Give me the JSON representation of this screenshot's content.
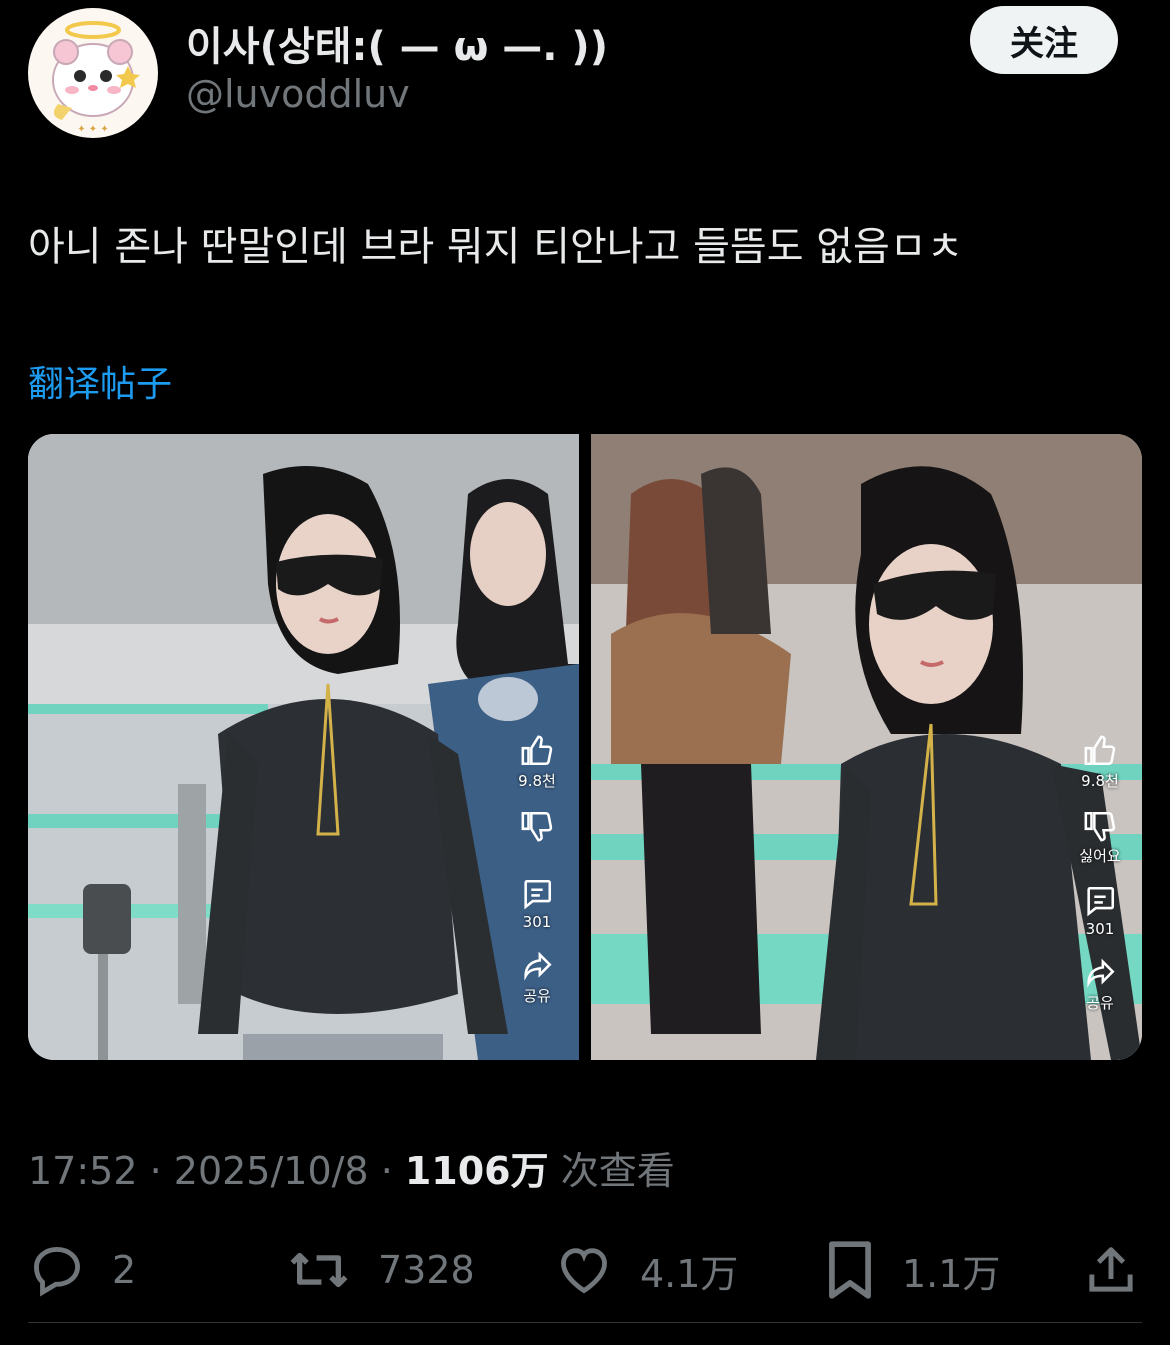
{
  "author": {
    "display_name": "이사(상태:( — ω —. ))",
    "handle": "@luvoddluv",
    "follow_label": "关注"
  },
  "post": {
    "text": "아니 존나 딴말인데 브라 뭐지 티안나고 들뜸도 없음ㅁㅊ",
    "translate_label": "翻译帖子"
  },
  "media": {
    "left_overlay": {
      "likes": "9.8천",
      "comments": "301",
      "share": "공유"
    },
    "right_overlay": {
      "likes": "9.8천",
      "dislike": "싫어요",
      "comments": "301",
      "share": "공유"
    }
  },
  "meta": {
    "time": "17:52",
    "separator": " · ",
    "date": "2025/10/8",
    "views": "1106万",
    "views_suffix": "次查看"
  },
  "actions": {
    "replies": "2",
    "reposts": "7328",
    "likes": "4.1万",
    "bookmarks": "1.1万"
  },
  "colors": {
    "background": "#000000",
    "text": "#e7e9ea",
    "muted": "#71767b",
    "link": "#1d9bf0",
    "follow_bg": "#eff3f4"
  }
}
